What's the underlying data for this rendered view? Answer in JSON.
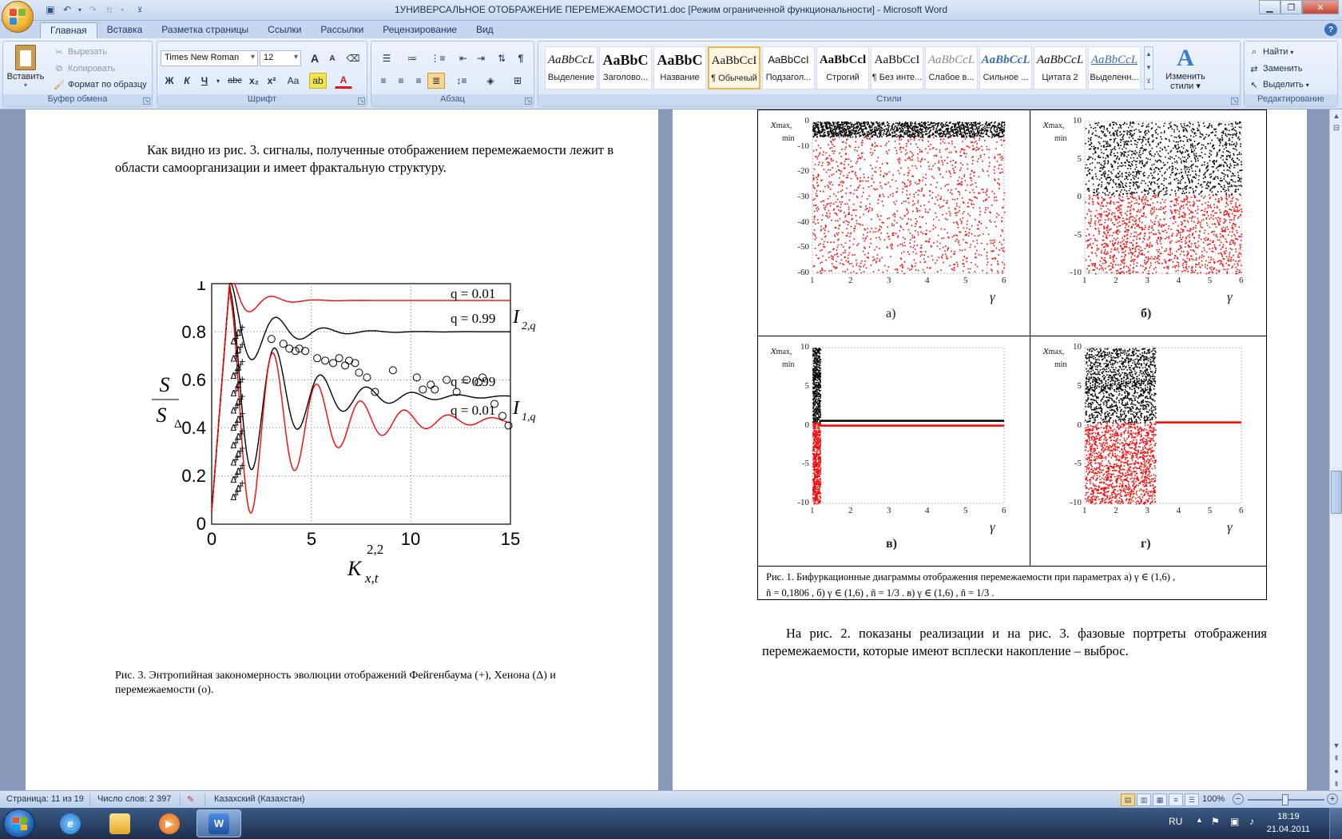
{
  "window": {
    "title": "1УНИВЕРСАЛЬНОЕ ОТОБРАЖЕНИЕ ПЕРЕМЕЖАЕМОСТИ1.doc [Режим ограниченной функциональности] - Microsoft Word"
  },
  "tabs": [
    {
      "label": "Главная",
      "active": true
    },
    {
      "label": "Вставка"
    },
    {
      "label": "Разметка страницы"
    },
    {
      "label": "Ссылки"
    },
    {
      "label": "Рассылки"
    },
    {
      "label": "Рецензирование"
    },
    {
      "label": "Вид"
    }
  ],
  "ribbon": {
    "clipboard": {
      "label": "Буфер обмена",
      "paste": "Вставить",
      "cut": "Вырезать",
      "copy": "Копировать",
      "format_painter": "Формат по образцу"
    },
    "font": {
      "label": "Шрифт",
      "font_name": "Times New Roman",
      "font_size": "12",
      "bold": "Ж",
      "italic": "К",
      "underline": "Ч",
      "strike": "abc",
      "subscript": "x₂",
      "superscript": "x²",
      "change_case": "Aa",
      "grow": "A",
      "shrink": "A",
      "font_color": "A"
    },
    "paragraph": {
      "label": "Абзац",
      "pilcrow": "¶"
    },
    "styles": {
      "label": "Стили",
      "items": [
        {
          "sample": "AaBbCcL",
          "name": "Выделение"
        },
        {
          "sample": "AaBbC",
          "name": "Заголово..."
        },
        {
          "sample": "AaBbC",
          "name": "Название"
        },
        {
          "sample": "AaBbCcI",
          "name": "¶ Обычный",
          "active": true
        },
        {
          "sample": "AaBbCcI",
          "name": "Подзагол..."
        },
        {
          "sample": "AaBbCcl",
          "name": "Строгий"
        },
        {
          "sample": "AaBbCcI",
          "name": "¶ Без инте..."
        },
        {
          "sample": "AaBbCcL",
          "name": "Слабое в..."
        },
        {
          "sample": "AaBbCcL",
          "name": "Сильное ..."
        },
        {
          "sample": "AaBbCcL",
          "name": "Цитата 2"
        },
        {
          "sample": "AaBbCcL",
          "name": "Выделенн..."
        }
      ],
      "change_styles_line1": "Изменить",
      "change_styles_line2": "стили"
    },
    "editing": {
      "label": "Редактирование",
      "find": "Найти",
      "replace": "Заменить",
      "select": "Выделить"
    }
  },
  "page1": {
    "paragraph": "Как видно из рис. 3. сигналы, полученные отображением перемежаемости лежит в области самоорганизации и имеет фрактальную структуру.",
    "figure": {
      "ylabel_top": "S",
      "ylabel_bottom": "S",
      "ylabel_sub": "Δ",
      "xlabel": "K",
      "xlabel_sup": "2,2",
      "xlabel_sub": "x,t",
      "yticks": [
        "0",
        "0.2",
        "0.4",
        "0.6",
        "0.8",
        "1"
      ],
      "xticks": [
        "0",
        "5",
        "10",
        "15"
      ],
      "annotations": [
        {
          "text": "q = 0.01"
        },
        {
          "text": "q = 0.99"
        },
        {
          "text": "q = 0.99"
        },
        {
          "text": "q = 0.01"
        }
      ],
      "label_i2": "I",
      "label_i2_sub": "2,q",
      "label_i1": "I",
      "label_i1_sub": "1,q"
    },
    "caption": "Рис. 3. Энтропийная закономерность эволюции отображений Фейгенбаума (+), Хенона (Δ) и перемежаемости (о)."
  },
  "page2": {
    "panels": [
      {
        "letter": "а)",
        "yticks": [
          "0",
          "-10",
          "-20",
          "-30",
          "-40",
          "-50",
          "-60"
        ],
        "xticks": [
          "1",
          "2",
          "3",
          "4",
          "5",
          "6"
        ]
      },
      {
        "letter": "б)",
        "yticks": [
          "10",
          "5",
          "0",
          "-5",
          "-10"
        ],
        "xticks": [
          "1",
          "2",
          "3",
          "4",
          "5",
          "6"
        ]
      },
      {
        "letter": "в)",
        "yticks": [
          "10",
          "5",
          "0",
          "-5",
          "-10"
        ],
        "xticks": [
          "1",
          "2",
          "3",
          "4",
          "5",
          "6"
        ]
      },
      {
        "letter": "г)",
        "yticks": [
          "10",
          "5",
          "0",
          "-5",
          "-10"
        ],
        "xticks": [
          "1",
          "2",
          "3",
          "4",
          "5",
          "6"
        ]
      }
    ],
    "ylabel": "x",
    "ylabel_sub1": "max,",
    "ylabel_sub2": "min",
    "xlabel": "γ",
    "caption_line1": "Рис. 1. Бифуркационные диаграммы отображения перемежаемости при параметрах а) γ ∈ (1,6) ,",
    "caption_line2": "ñ = 0,1806 , б) γ ∈ (1,6) , ñ = 1/3 . в) γ ∈ (1,6) , ñ = 1/3 .",
    "paragraph": "На рис. 2. показаны реализации и на рис. 3. фазовые портреты отображения перемежаемости, которые имеют всплески накопление – выброс."
  },
  "status": {
    "page": "Страница: 11 из 19",
    "words": "Число слов: 2 397",
    "language": "Казахский (Казахстан)",
    "zoom": "100%"
  },
  "taskbar": {
    "lang": "RU",
    "time": "18:19",
    "date": "21.04.2011"
  },
  "colors": {
    "series_black": "#000000",
    "series_red": "#ff0000"
  }
}
